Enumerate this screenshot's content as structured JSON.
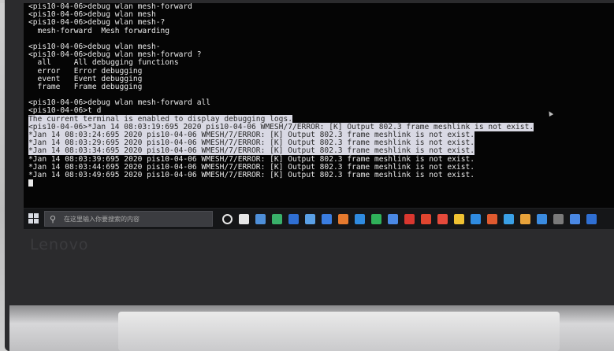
{
  "terminal": {
    "lines": [
      {
        "text": "<pis10-04-06>debug wlan mesh-forward",
        "hl": false
      },
      {
        "text": "<pis10-04-06>debug wlan mesh",
        "hl": false
      },
      {
        "text": "<pis10-04-06>debug wlan mesh-?",
        "hl": false
      },
      {
        "text": "  mesh-forward  Mesh forwarding",
        "hl": false
      },
      {
        "text": "",
        "hl": false
      },
      {
        "text": "<pis10-04-06>debug wlan mesh-",
        "hl": false
      },
      {
        "text": "<pis10-04-06>debug wlan mesh-forward ?",
        "hl": false
      },
      {
        "text": "  all     All debugging functions",
        "hl": false
      },
      {
        "text": "  error   Error debugging",
        "hl": false
      },
      {
        "text": "  event   Event debugging",
        "hl": false
      },
      {
        "text": "  frame   Frame debugging",
        "hl": false
      },
      {
        "text": "",
        "hl": false
      },
      {
        "text": "<pis10-04-06>debug wlan mesh-forward all",
        "hl": false
      },
      {
        "text": "<pis10-04-06>t d",
        "hl": false
      },
      {
        "text": "The current terminal is enabled to display debugging logs.",
        "hl": true
      },
      {
        "text": "<pis10-04-06>*Jan 14 08:03:19:695 2020 pis10-04-06 WMESH/7/ERROR: [K] Output 802.3 frame meshlink is not exist.",
        "hl": true
      },
      {
        "text": "*Jan 14 08:03:24:695 2020 pis10-04-06 WMESH/7/ERROR: [K] Output 802.3 frame meshlink is not exist.",
        "hl": true
      },
      {
        "text": "*Jan 14 08:03:29:695 2020 pis10-04-06 WMESH/7/ERROR: [K] Output 802.3 frame meshlink is not exist.",
        "hl": true
      },
      {
        "text": "*Jan 14 08:03:34:695 2020 pis10-04-06 WMESH/7/ERROR: [K] Output 802.3 frame meshlink is not exist.",
        "hl": true
      },
      {
        "text": "*Jan 14 08:03:39:695 2020 pis10-04-06 WMESH/7/ERROR: [K] Output 802.3 frame meshlink is not exist.",
        "hl": false
      },
      {
        "text": "*Jan 14 08:03:44:695 2020 pis10-04-06 WMESH/7/ERROR: [K] Output 802.3 frame meshlink is not exist.",
        "hl": false
      },
      {
        "text": "*Jan 14 08:03:49:695 2020 pis10-04-06 WMESH/7/ERROR: [K] Output 802.3 frame meshlink is not exist.",
        "hl": false
      }
    ]
  },
  "taskbar": {
    "search_placeholder": "在这里输入你要搜索的内容",
    "apps": [
      {
        "icon": "cortana-icon",
        "color": "#e6e6e6"
      },
      {
        "icon": "task-view-icon",
        "color": "#e6e6e6"
      },
      {
        "icon": "app-icon-1",
        "color": "#4e8fd9"
      },
      {
        "icon": "app-icon-2",
        "color": "#39b06a"
      },
      {
        "icon": "app-icon-3",
        "color": "#2f6fd3"
      },
      {
        "icon": "app-icon-4",
        "color": "#5aa0e6"
      },
      {
        "icon": "app-icon-5",
        "color": "#3a7de0"
      },
      {
        "icon": "app-icon-6",
        "color": "#e67a2e"
      },
      {
        "icon": "app-icon-7",
        "color": "#2f8be0"
      },
      {
        "icon": "app-icon-8",
        "color": "#2fb15a"
      },
      {
        "icon": "app-icon-9",
        "color": "#4a88e4"
      },
      {
        "icon": "app-icon-10",
        "color": "#d9372f"
      },
      {
        "icon": "app-icon-11",
        "color": "#e0452f"
      },
      {
        "icon": "app-icon-12",
        "color": "#e64a3b"
      },
      {
        "icon": "app-icon-13",
        "color": "#f0c232"
      },
      {
        "icon": "app-icon-14",
        "color": "#2f8be0"
      },
      {
        "icon": "app-icon-15",
        "color": "#e05a2f"
      },
      {
        "icon": "app-icon-16",
        "color": "#3aa0e6"
      },
      {
        "icon": "app-icon-17",
        "color": "#e8a23a"
      },
      {
        "icon": "app-icon-18",
        "color": "#3a8be0"
      },
      {
        "icon": "app-icon-19",
        "color": "#7a7a7a"
      },
      {
        "icon": "app-icon-20",
        "color": "#4a88e4"
      },
      {
        "icon": "app-icon-21",
        "color": "#2f6fd3"
      }
    ]
  },
  "brand": "Lenovo"
}
